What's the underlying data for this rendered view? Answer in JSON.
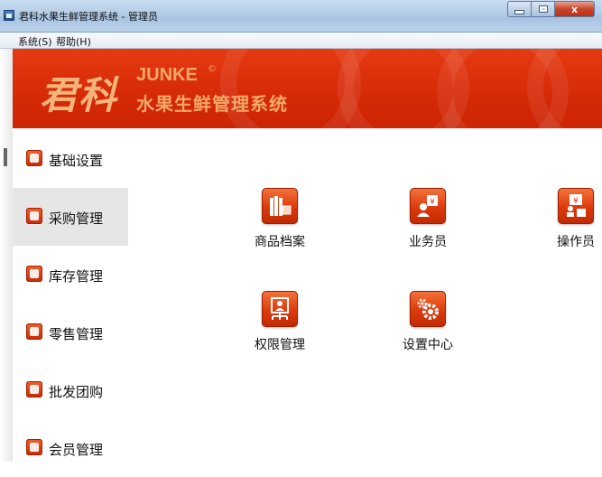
{
  "window": {
    "title": "君科水果生鲜管理系统 - 管理员",
    "controls": {
      "minimize": "",
      "maximize": "",
      "close": "x"
    }
  },
  "menu": [
    {
      "label": "系统(S)"
    },
    {
      "label": "帮助(H)"
    }
  ],
  "banner": {
    "logo": "君科",
    "brand_en": "JUNKE",
    "registered_mark": "©",
    "brand_cn": "水果生鲜管理系统"
  },
  "sidebar": {
    "items": [
      {
        "label": "基础设置",
        "icon": "settings-icon",
        "active": false
      },
      {
        "label": "采购管理",
        "icon": "purchase-icon",
        "active": true
      },
      {
        "label": "库存管理",
        "icon": "inventory-icon",
        "active": false
      },
      {
        "label": "零售管理",
        "icon": "retail-icon",
        "active": false
      },
      {
        "label": "批发团购",
        "icon": "wholesale-icon",
        "active": false
      },
      {
        "label": "会员管理",
        "icon": "member-icon",
        "active": false
      }
    ]
  },
  "tiles": [
    {
      "label": "商品档案",
      "icon": "product-archive-icon"
    },
    {
      "label": "业务员",
      "icon": "salesperson-icon"
    },
    {
      "label": "操作员",
      "icon": "operator-icon"
    },
    {
      "label": "权限管理",
      "icon": "permission-icon"
    },
    {
      "label": "设置中心",
      "icon": "gear-icon"
    }
  ],
  "colors": {
    "banner_red": "#d62a07",
    "brand_orange": "#f3a86a",
    "tile_red": "#dc3a0c",
    "active_item_bg": "#e6e6e6"
  }
}
